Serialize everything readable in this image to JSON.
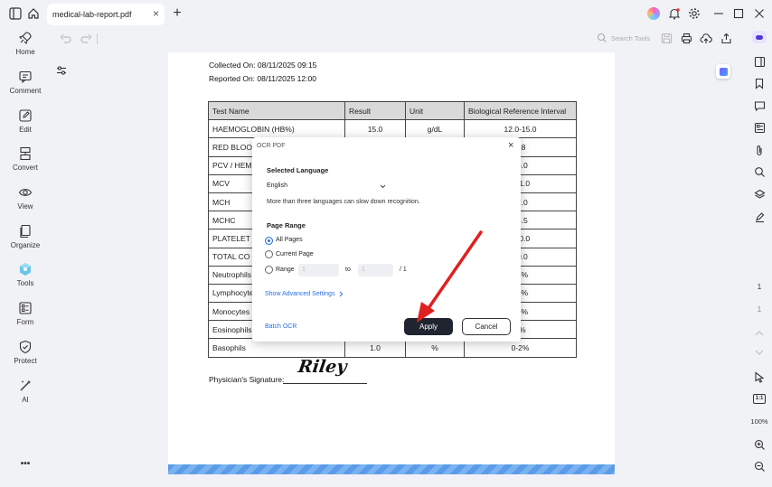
{
  "titlebar": {
    "tab_label": "medical-lab-report.pdf",
    "tab_close": "×",
    "new_tab": "+"
  },
  "sidebar": {
    "items": [
      {
        "label": "Home",
        "icon": "rocket-icon"
      },
      {
        "label": "Comment",
        "icon": "comment-icon"
      },
      {
        "label": "Edit",
        "icon": "edit-icon"
      },
      {
        "label": "Convert",
        "icon": "convert-icon"
      },
      {
        "label": "View",
        "icon": "eye-icon"
      },
      {
        "label": "Organize",
        "icon": "organize-icon"
      },
      {
        "label": "Tools",
        "icon": "tools-icon"
      },
      {
        "label": "Form",
        "icon": "form-icon"
      },
      {
        "label": "Protect",
        "icon": "shield-icon"
      },
      {
        "label": "AI",
        "icon": "ai-icon"
      }
    ],
    "more": "•••"
  },
  "toolbar": {
    "search_placeholder": "Search Tools"
  },
  "document": {
    "collected_on": "Collected On: 08/11/2025 09:15",
    "reported_on": "Reported On: 08/11/2025 12:00",
    "table_headers": [
      "Test Name",
      "Result",
      "Unit",
      "Biological Reference Interval"
    ],
    "rows": [
      [
        "HAEMOGLOBIN (HB%)",
        "15.0",
        "g/dL",
        "12.0-15.0"
      ],
      [
        "RED BLOO",
        "",
        "",
        "4.8"
      ],
      [
        "PCV / HEM",
        "",
        "",
        "46.0"
      ],
      [
        "MCV",
        "",
        "",
        "101.0"
      ],
      [
        "MCH",
        "",
        "",
        "32.0"
      ],
      [
        "MCHC",
        "",
        "",
        "34.5"
      ],
      [
        "PLATELET",
        "",
        "",
        "450.0"
      ],
      [
        "TOTAL CO",
        "",
        "",
        "10.0"
      ],
      [
        "Neutrophils",
        "",
        "",
        "75%"
      ],
      [
        "Lymphocyte",
        "",
        "",
        "40%"
      ],
      [
        "Monocytes",
        "",
        "",
        "10%"
      ],
      [
        "Eosinophils",
        "",
        "",
        "6%"
      ],
      [
        "Basophils",
        "1.0",
        "%",
        "0-2%"
      ]
    ],
    "signature_label": "Physician's Signature:",
    "signature_name": "Riley"
  },
  "dialog": {
    "title": "OCR PDF",
    "close": "×",
    "language_label": "Selected Language",
    "language_value": "English",
    "language_hint": "More than three languages can slow down recognition.",
    "page_range_label": "Page Range",
    "opt_all": "All Pages",
    "opt_current": "Current Page",
    "opt_range": "Range",
    "range_to": "to",
    "range_total": "/ 1",
    "range_from_value": "1",
    "range_to_value": "1",
    "advanced": "Show Advanced Settings",
    "batch": "Batch OCR",
    "apply": "Apply",
    "cancel": "Cancel"
  },
  "rightbar": {
    "page_current": "1",
    "page_total": "1",
    "zoom": "100%",
    "fit_label": "1:1"
  },
  "colors": {
    "accent": "#2b6fe0",
    "arrow": "#e02020",
    "apply_bg": "#1f2430"
  }
}
